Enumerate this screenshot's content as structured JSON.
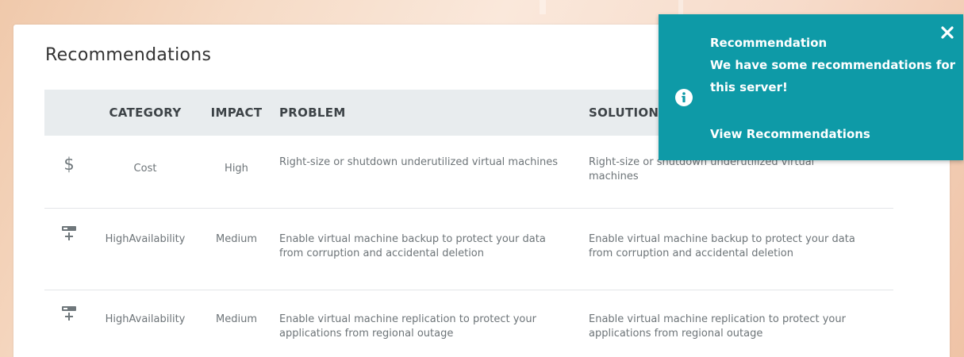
{
  "recommendations": {
    "title": "Recommendations",
    "columns": {
      "icon": "",
      "category": "CATEGORY",
      "impact": "IMPACT",
      "problem": "PROBLEM",
      "solution": "SOLUTION"
    },
    "rows": [
      {
        "icon": "dollar-icon",
        "icon_glyph": "$",
        "category": "Cost",
        "impact": "High",
        "problem": "Right-size or shutdown underutilized virtual machines",
        "solution": "Right-size or shutdown underutilized virtual machines"
      },
      {
        "icon": "server-plus-icon",
        "category": "HighAvailability",
        "impact": "Medium",
        "problem": "Enable virtual machine backup to protect your data from corruption and accidental deletion",
        "solution": "Enable virtual machine backup to protect your data from corruption and accidental deletion"
      },
      {
        "icon": "server-plus-icon",
        "category": "HighAvailability",
        "impact": "Medium",
        "problem": "Enable virtual machine replication to protect your applications from regional outage",
        "solution": "Enable virtual machine replication to protect your applications from regional outage"
      }
    ]
  },
  "toast": {
    "title": "Recommendation",
    "message": "We have some recommendations for this server!",
    "link": "View Recommendations",
    "icon": "info-icon",
    "close_icon": "close-icon",
    "color": "#0e9aa7"
  },
  "colors": {
    "header_bg": "#e8ecee",
    "text_muted": "#6d7478",
    "heading": "#3d4347"
  }
}
